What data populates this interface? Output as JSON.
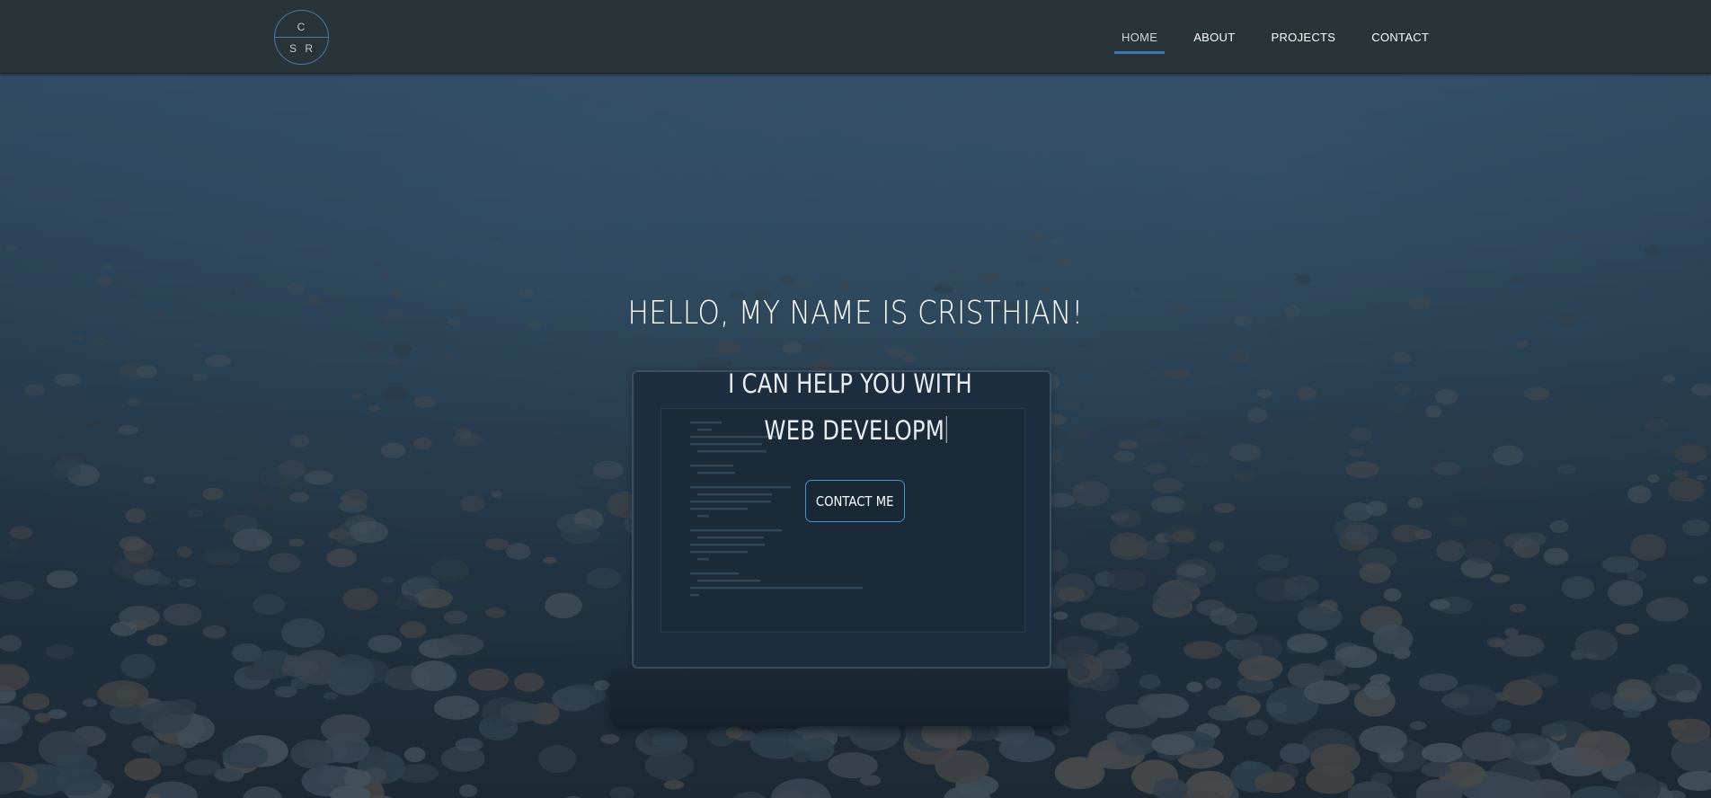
{
  "logo": {
    "top_letter": "C",
    "bottom_letters": "S R"
  },
  "nav": {
    "items": [
      {
        "label": "HOME",
        "active": true
      },
      {
        "label": "ABOUT",
        "active": false
      },
      {
        "label": "PROJECTS",
        "active": false
      },
      {
        "label": "CONTACT",
        "active": false
      }
    ]
  },
  "hero": {
    "title": "HELLO, MY NAME IS CRISTHIAN!",
    "subtitle_line1": "I CAN HELP YOU WITH",
    "subtitle_line2": "WEB DEVELOPM",
    "cta_label": "CONTACT ME"
  },
  "colors": {
    "navbar_bg": "#283437",
    "accent": "#3a77b0",
    "button_border": "#4a8fcf",
    "text": "#ffffff"
  }
}
